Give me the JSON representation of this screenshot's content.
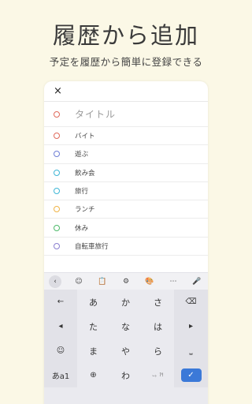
{
  "promo": {
    "headline": "履歴から追加",
    "subline": "予定を履歴から簡単に登録できる"
  },
  "app": {
    "close_icon": "×",
    "title_placeholder": "タイトル",
    "title_dot_color": "#e06a5b",
    "history": [
      {
        "label": "バイト",
        "color": "#e06a5b"
      },
      {
        "label": "遊ぶ",
        "color": "#6f7fd6"
      },
      {
        "label": "飲み会",
        "color": "#3fb6d6"
      },
      {
        "label": "旅行",
        "color": "#3fb6d6"
      },
      {
        "label": "ランチ",
        "color": "#f0b447"
      },
      {
        "label": "休み",
        "color": "#4dba6a"
      },
      {
        "label": "自転車旅行",
        "color": "#8a7fd0"
      }
    ]
  },
  "keyboard": {
    "toolbar": [
      "‹",
      "☺",
      "📋",
      "⚙",
      "🎨",
      "⋯",
      "🎤"
    ],
    "rows": [
      [
        "←",
        "あ",
        "か",
        "さ",
        "⌫"
      ],
      [
        "◂",
        "た",
        "な",
        "は",
        "▸"
      ],
      [
        "☺",
        "ま",
        "や",
        "ら",
        "⎵"
      ],
      [
        "あa1",
        "⊕",
        "わ",
        "、。?!",
        "✓"
      ]
    ]
  }
}
